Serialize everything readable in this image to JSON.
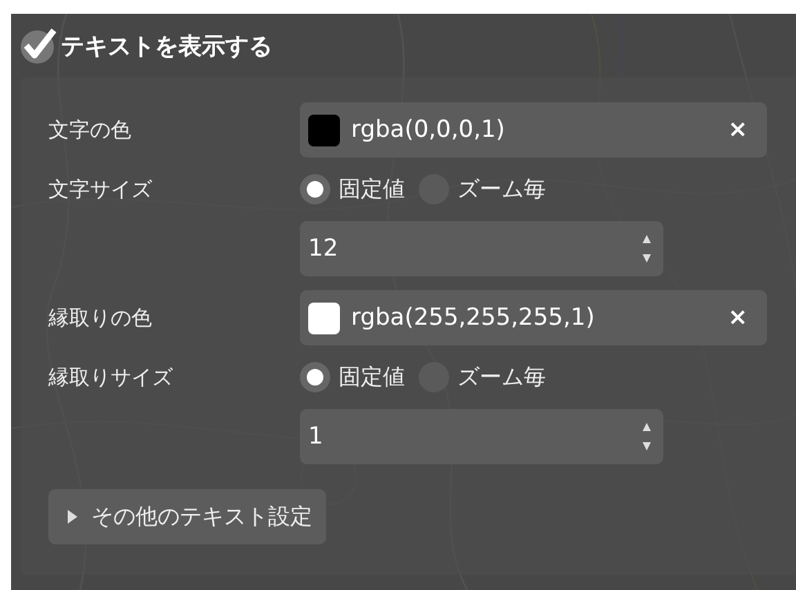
{
  "header": {
    "label": "テキストを表示する",
    "checked": true
  },
  "rows": [
    {
      "kind": "color",
      "label": "文字の色",
      "value": "rgba(0,0,0,1)",
      "color": "#000000",
      "clear": "×"
    },
    {
      "kind": "size",
      "label": "文字サイズ",
      "options": [
        {
          "label": "固定値",
          "selected": true
        },
        {
          "label": "ズーム毎",
          "selected": false
        }
      ],
      "value": "12"
    },
    {
      "kind": "color",
      "label": "縁取りの色",
      "value": "rgba(255,255,255,1)",
      "color": "#ffffff",
      "clear": "×"
    },
    {
      "kind": "size",
      "label": "縁取りサイズ",
      "options": [
        {
          "label": "固定値",
          "selected": true
        },
        {
          "label": "ズーム毎",
          "selected": false
        }
      ],
      "value": "1"
    }
  ],
  "more_button": {
    "label": "その他のテキスト設定"
  }
}
